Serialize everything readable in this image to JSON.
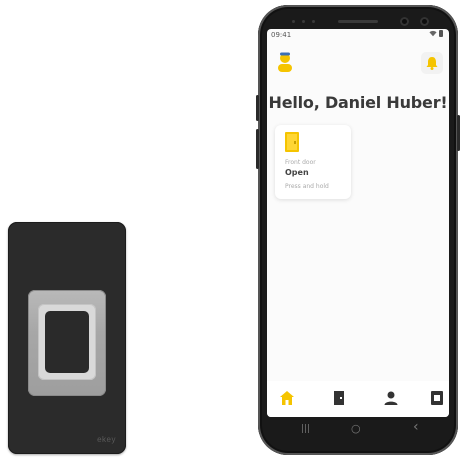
{
  "reader": {
    "brand": "ekey"
  },
  "status_bar": {
    "time": "09:41",
    "wifi": "wifi-icon",
    "battery": "battery-icon"
  },
  "header": {
    "avatar": "avatar-icon",
    "notifications": "bell-icon"
  },
  "greeting": "Hello, Daniel Huber!",
  "door_card": {
    "icon": "door-icon",
    "label": "Front door",
    "status": "Open",
    "hint": "Press and hold"
  },
  "tabbar": {
    "items": [
      {
        "icon": "home-icon",
        "active": true
      },
      {
        "icon": "door-icon",
        "active": false
      },
      {
        "icon": "user-icon",
        "active": false
      },
      {
        "icon": "device-icon",
        "active": false
      }
    ]
  },
  "system_nav": {
    "recent": "|||",
    "home": "○",
    "back": "‹"
  },
  "colors": {
    "accent": "#F5C400",
    "text": "#3a3a3a",
    "screen_bg": "#fbfbfb",
    "reader_body": "#2b2b2b"
  }
}
